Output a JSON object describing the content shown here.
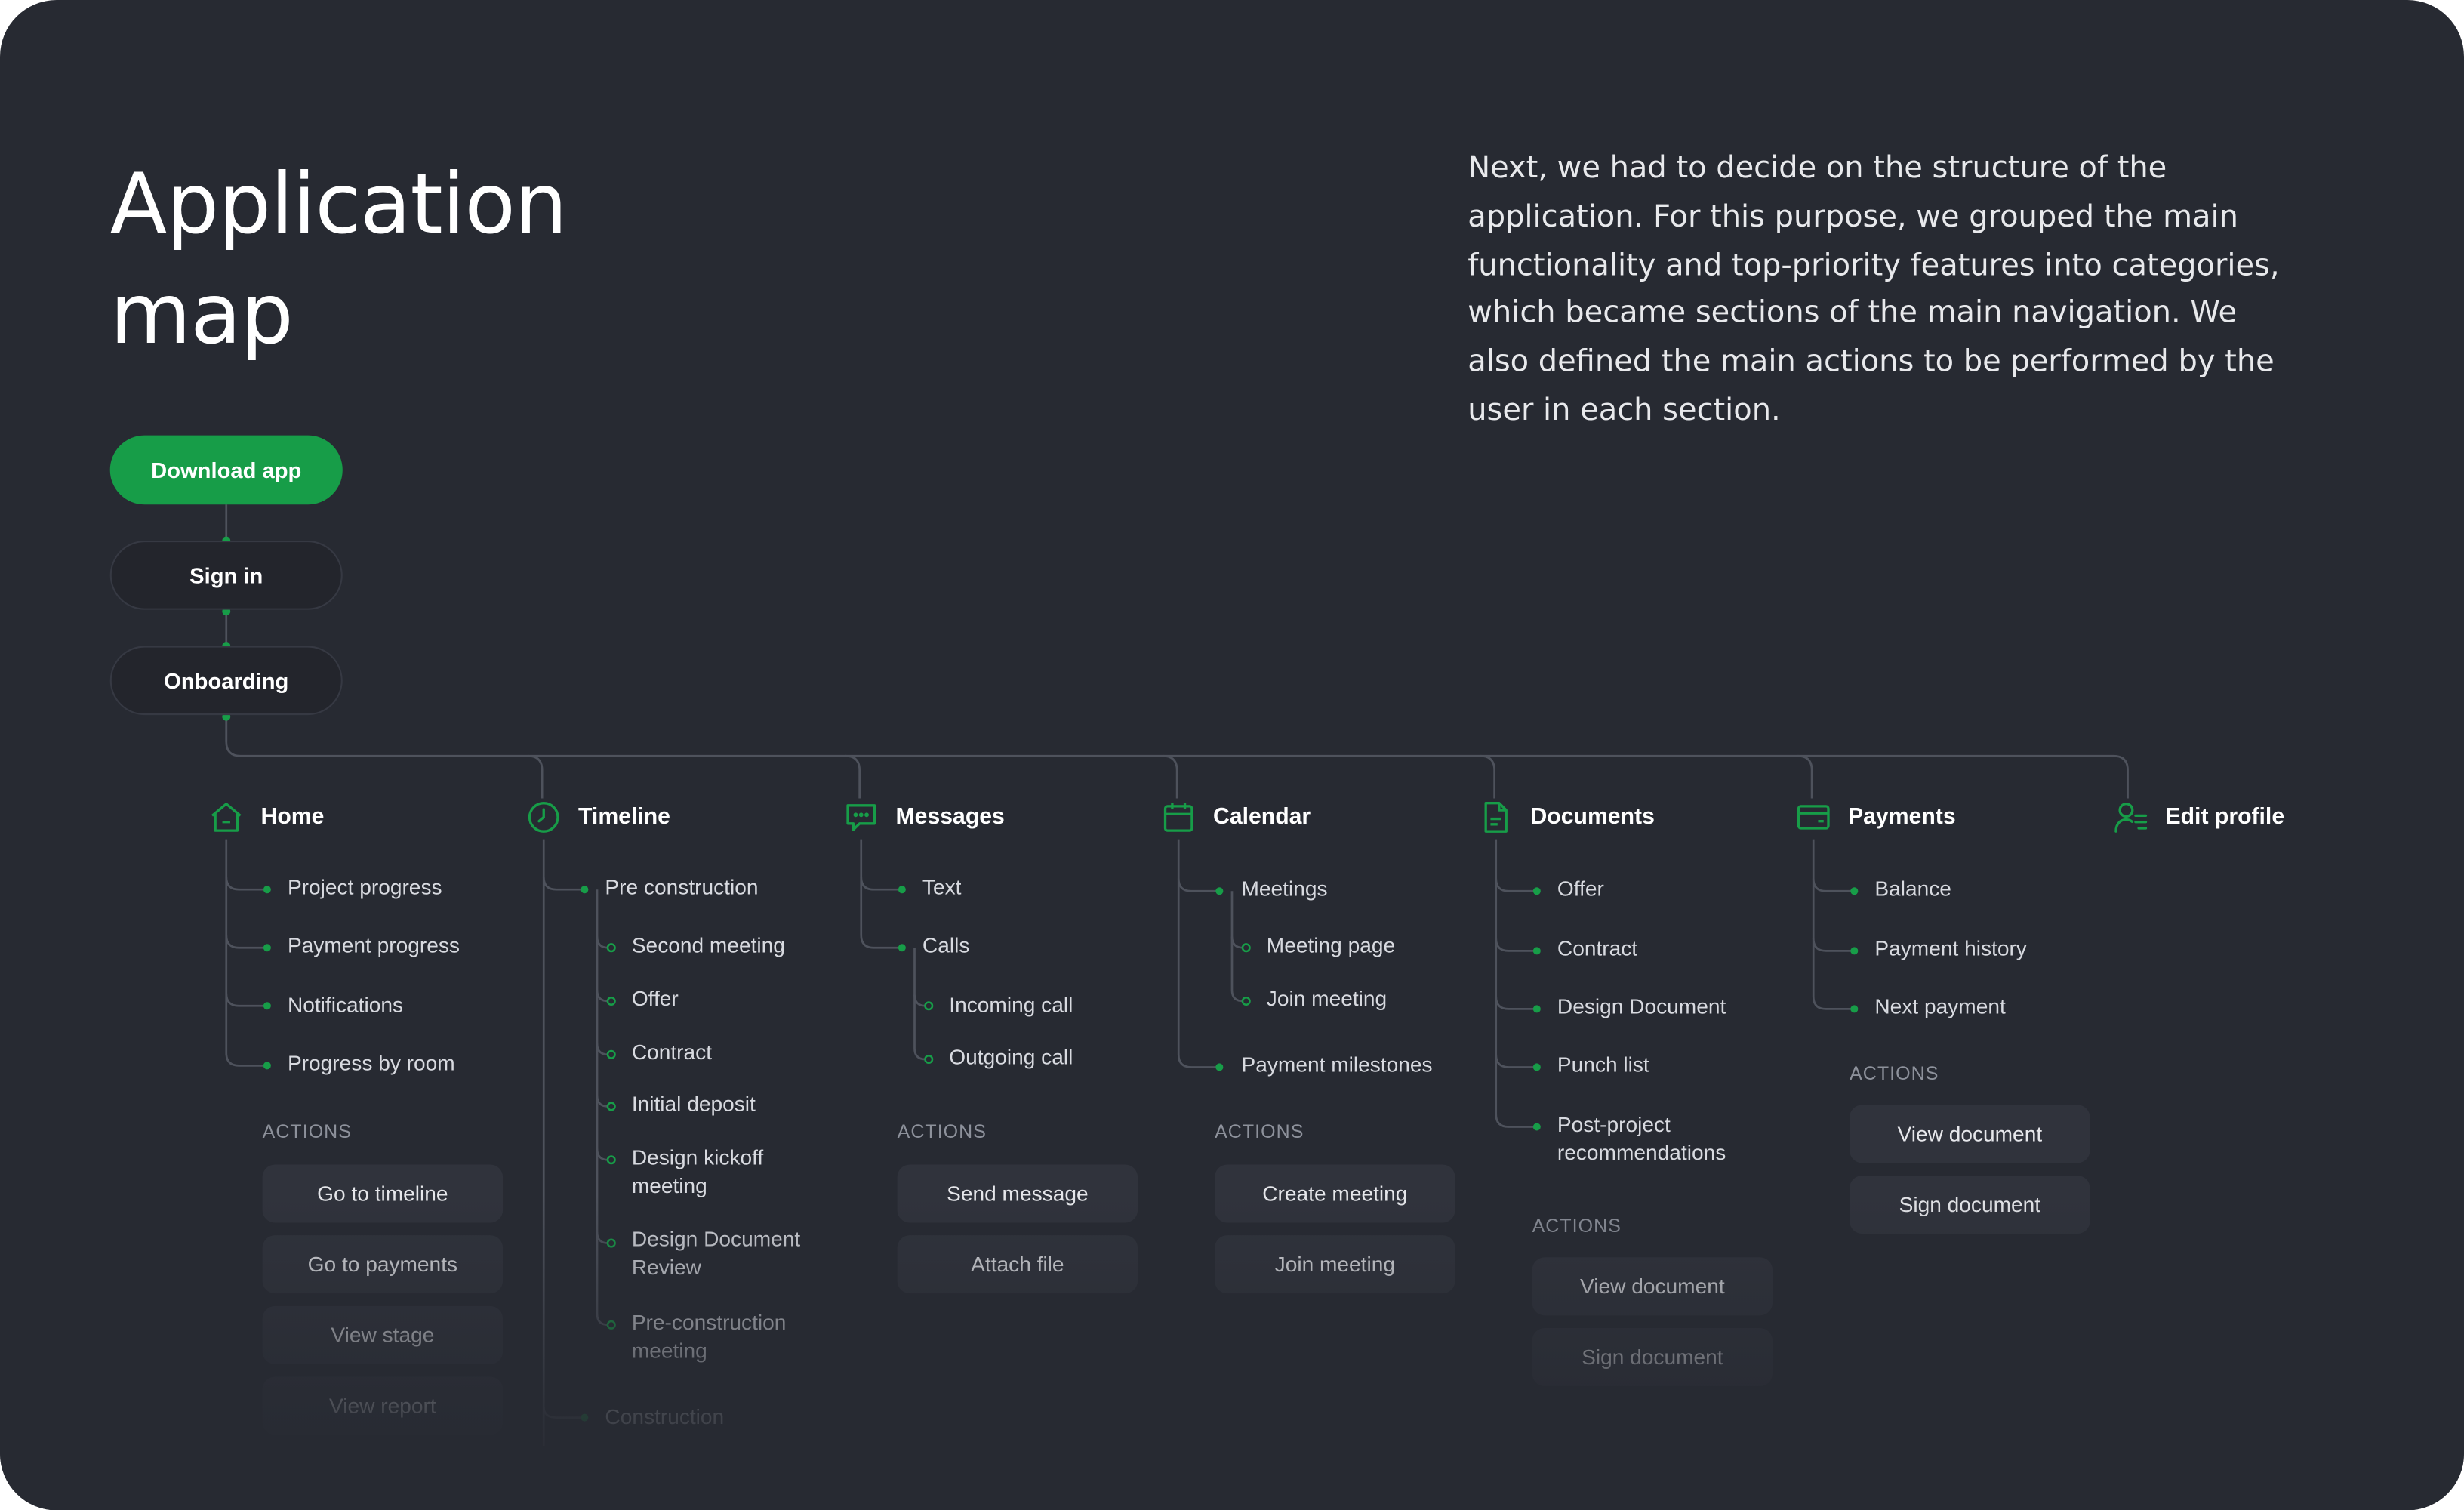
{
  "title_line1": "Application",
  "title_line2": "map",
  "intro": "Next, we had to decide on the structure of the application. For this purpose, we grouped the main functionality and top-priority features into categories, which became sections of the main navigation. We also defined the main actions to be performed by the user in each section.",
  "flow": {
    "download": "Download app",
    "signin": "Sign in",
    "onboarding": "Onboarding"
  },
  "actions_label": "ACTIONS",
  "colors": {
    "accent": "#179d48",
    "background": "#272a32",
    "button": "#30333c"
  },
  "sections": {
    "home": {
      "label": "Home",
      "icon": "home-icon",
      "items": [
        "Project progress",
        "Payment progress",
        "Notifications",
        "Progress by room"
      ],
      "actions": [
        "Go to timeline",
        "Go to payments",
        "View stage",
        "View report"
      ]
    },
    "timeline": {
      "label": "Timeline",
      "icon": "clock-icon",
      "items": [
        "Pre construction",
        "Second meeting",
        "Offer",
        "Contract",
        "Initial deposit",
        "Design kickoff meeting",
        "Design Document Review",
        "Pre-construction meeting",
        "Construction"
      ]
    },
    "messages": {
      "label": "Messages",
      "icon": "chat-icon",
      "items": [
        "Text",
        "Calls",
        "Incoming call",
        "Outgoing call"
      ],
      "actions": [
        "Send message",
        "Attach file"
      ]
    },
    "calendar": {
      "label": "Calendar",
      "icon": "calendar-icon",
      "items": [
        "Meetings",
        "Meeting page",
        "Join meeting",
        "Payment milestones"
      ],
      "actions": [
        "Create meeting",
        "Join meeting"
      ]
    },
    "documents": {
      "label": "Documents",
      "icon": "document-icon",
      "items": [
        "Offer",
        "Contract",
        "Design Document",
        "Punch list",
        "Post-project recommendations"
      ],
      "actions": [
        "View document",
        "Sign document"
      ]
    },
    "payments": {
      "label": "Payments",
      "icon": "card-icon",
      "items": [
        "Balance",
        "Payment history",
        "Next payment"
      ],
      "actions": [
        "View document",
        "Sign document"
      ]
    },
    "profile": {
      "label": "Edit profile",
      "icon": "user-edit-icon"
    }
  }
}
